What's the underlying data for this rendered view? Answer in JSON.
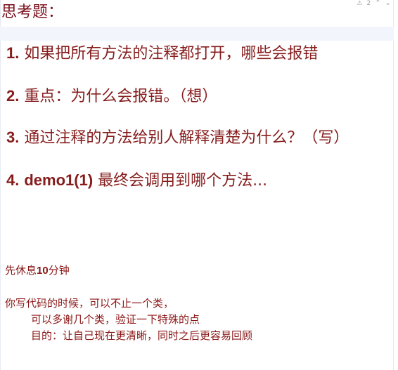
{
  "title": "思考题：",
  "editor_indicator": {
    "warning_count": "2"
  },
  "questions": [
    {
      "num": "1.",
      "text": "如果把所有方法的注释都打开，哪些会报错"
    },
    {
      "num": "2.",
      "text": "重点：为什么会报错。（想）"
    },
    {
      "num": "3.",
      "text": "通过注释的方法给别人解释清楚为什么？（写）"
    },
    {
      "num": "4.",
      "bold_text": "demo1(1)",
      "text": "最终会调用到哪个方法..."
    }
  ],
  "rest": {
    "prefix": "先休息",
    "minutes": "10",
    "suffix": "分钟"
  },
  "notes": {
    "line1": "你写代码的时候，可以不止一个类，",
    "line2": "可以多谢几个类，验证一下特殊的点",
    "line3": "目的：让自己现在更清晰，同时之后更容易回顾"
  }
}
